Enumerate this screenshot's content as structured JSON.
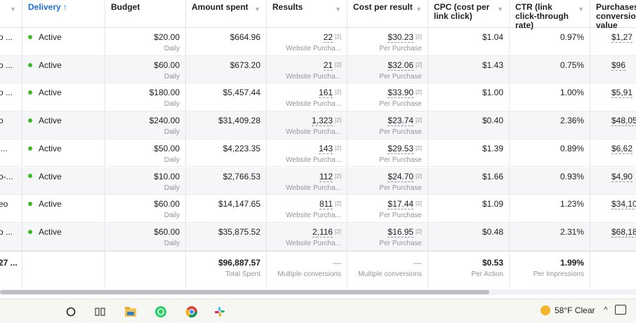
{
  "header": {
    "delivery": "Delivery ↑",
    "budget": "Budget",
    "amount_spent": "Amount spent",
    "results": "Results",
    "cost_per_result": "Cost per result",
    "cpc": "CPC (cost per link click)",
    "ctr": "CTR (link click-through rate)",
    "purchases_value": "Purchases conversion value"
  },
  "rows": [
    {
      "name": "o ...",
      "delivery": "Active",
      "budget": "$20.00",
      "budget_type": "Daily",
      "amount": "$664.96",
      "results": "22",
      "results_note": "[2]",
      "results_type": "Website Purcha...",
      "cpr": "$30.23",
      "cpr_note": "[2]",
      "cpr_type": "Per Purchase",
      "cpc": "$1.04",
      "ctr": "0.97%",
      "pcv": "$1,27"
    },
    {
      "name": "o ...",
      "delivery": "Active",
      "budget": "$60.00",
      "budget_type": "Daily",
      "amount": "$673.20",
      "results": "21",
      "results_note": "[2]",
      "results_type": "Website Purcha...",
      "cpr": "$32.06",
      "cpr_note": "[2]",
      "cpr_type": "Per Purchase",
      "cpc": "$1.43",
      "ctr": "0.75%",
      "pcv": "$96"
    },
    {
      "name": "o ...",
      "delivery": "Active",
      "budget": "$180.00",
      "budget_type": "Daily",
      "amount": "$5,457.44",
      "results": "161",
      "results_note": "[2]",
      "results_type": "Website Purcha...",
      "cpr": "$33.90",
      "cpr_note": "[2]",
      "cpr_type": "Per Purchase",
      "cpc": "$1.00",
      "ctr": "1.00%",
      "pcv": "$5,91"
    },
    {
      "name": "o",
      "delivery": "Active",
      "budget": "$240.00",
      "budget_type": "Daily",
      "amount": "$31,409.28",
      "results": "1,323",
      "results_note": "[2]",
      "results_type": "Website Purcha...",
      "cpr": "$23.74",
      "cpr_note": "[2]",
      "cpr_type": "Per Purchase",
      "cpc": "$0.40",
      "ctr": "2.36%",
      "pcv": "$48,05"
    },
    {
      "name": "i...",
      "delivery": "Active",
      "budget": "$50.00",
      "budget_type": "Daily",
      "amount": "$4,223.35",
      "results": "143",
      "results_note": "[2]",
      "results_type": "Website Purcha...",
      "cpr": "$29.53",
      "cpr_note": "[2]",
      "cpr_type": "Per Purchase",
      "cpc": "$1.39",
      "ctr": "0.89%",
      "pcv": "$6,62"
    },
    {
      "name": "o-...",
      "delivery": "Active",
      "budget": "$10.00",
      "budget_type": "Daily",
      "amount": "$2,766.53",
      "results": "112",
      "results_note": "[2]",
      "results_type": "Website Purcha...",
      "cpr": "$24.70",
      "cpr_note": "[2]",
      "cpr_type": "Per Purchase",
      "cpc": "$1.66",
      "ctr": "0.93%",
      "pcv": "$4,90"
    },
    {
      "name": "eo",
      "delivery": "Active",
      "budget": "$60.00",
      "budget_type": "Daily",
      "amount": "$14,147.65",
      "results": "811",
      "results_note": "[2]",
      "results_type": "Website Purcha...",
      "cpr": "$17.44",
      "cpr_note": "[2]",
      "cpr_type": "Per Purchase",
      "cpc": "$1.09",
      "ctr": "1.23%",
      "pcv": "$34,10"
    },
    {
      "name": "o ...",
      "delivery": "Active",
      "budget": "$60.00",
      "budget_type": "Daily",
      "amount": "$35,875.52",
      "results": "2,116",
      "results_note": "[2]",
      "results_type": "Website Purcha...",
      "cpr": "$16.95",
      "cpr_note": "[2]",
      "cpr_type": "Per Purchase",
      "cpc": "$0.48",
      "ctr": "2.31%",
      "pcv": "$68,18"
    }
  ],
  "totals": {
    "name": "27 ...",
    "amount": "$96,887.57",
    "amount_label": "Total Spent",
    "results": "—",
    "results_label": "Multiple conversions",
    "cpr": "—",
    "cpr_label": "Multiple conversions",
    "cpc": "$0.53",
    "cpc_label": "Per Action",
    "ctr": "1.99%",
    "ctr_label": "Per Impressions"
  },
  "taskbar": {
    "icons": [
      "search-circle-icon",
      "task-view-icon",
      "file-explorer-icon",
      "whatsapp-icon",
      "chrome-icon",
      "slack-icon"
    ],
    "weather": "58°F  Clear"
  },
  "colors": {
    "active_dot": "#42b72a",
    "link_blue": "#216fdb"
  }
}
